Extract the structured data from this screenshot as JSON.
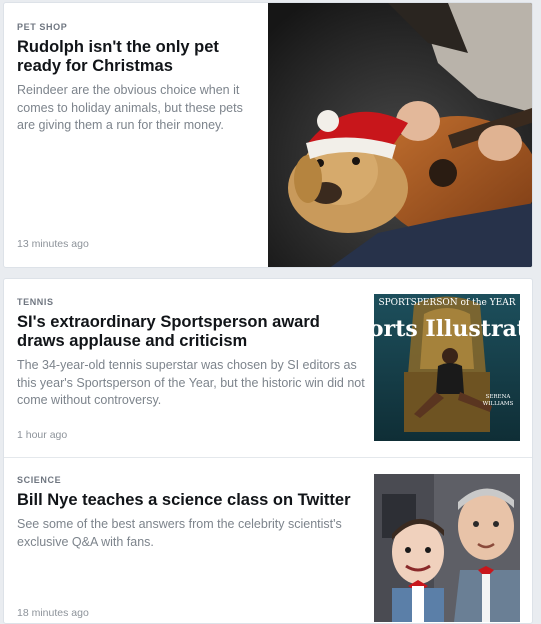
{
  "feed": {
    "articles": [
      {
        "category": "PET SHOP",
        "headline": "Rudolph isn't the only pet ready for Christmas",
        "summary": "Reindeer are the obvious choice when it comes to holiday animals, but these pets are giving them a run for their money.",
        "timestamp": "13 minutes ago",
        "image": "dog-in-santa-hat-guitar-photo"
      },
      {
        "category": "TENNIS",
        "headline": "SI's extraordinary Sportsperson award draws applause and criticism",
        "summary": "The 34-year-old tennis superstar was chosen by SI editors as this year's Sportsperson of the Year, but the historic win did not come without controversy.",
        "timestamp": "1 hour ago",
        "image": "sports-illustrated-cover",
        "cover_text": {
          "banner": "SPORTSPERSON of the YEAR",
          "masthead": "Sports Illustrated",
          "name_line1": "SERENA",
          "name_line2": "WILLIAMS"
        }
      },
      {
        "category": "SCIENCE",
        "headline": "Bill Nye teaches a science class on Twitter",
        "summary": "See some of the best answers from the celebrity scientist's exclusive Q&A with fans.",
        "timestamp": "18 minutes ago",
        "image": "bill-nye-with-puppet-photo"
      }
    ]
  },
  "colors": {
    "background": "#e9ecf0",
    "card": "#ffffff",
    "headline": "#111418",
    "summary": "#7d848c",
    "category": "#6f7680"
  }
}
